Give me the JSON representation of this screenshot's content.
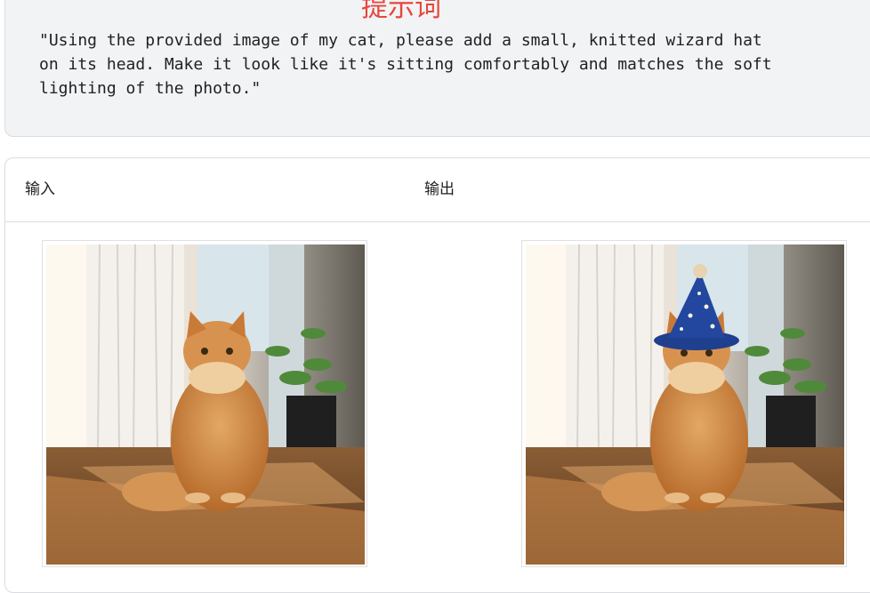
{
  "prompt": {
    "title": "提示词",
    "text": "\"Using the provided image of my cat, please add a small, knitted wizard hat\non its head. Make it look like it's sitting comfortably and matches the soft\nlighting of the photo.\""
  },
  "table": {
    "headers": {
      "input": "输入",
      "output": "输出"
    }
  },
  "images": {
    "input_icon": "cat-photo-icon",
    "output_icon": "cat-wizard-hat-photo-icon"
  },
  "colors": {
    "title_red": "#e8453c",
    "prompt_bg": "#f1f3f4",
    "hat_blue": "#1f3f8f"
  }
}
